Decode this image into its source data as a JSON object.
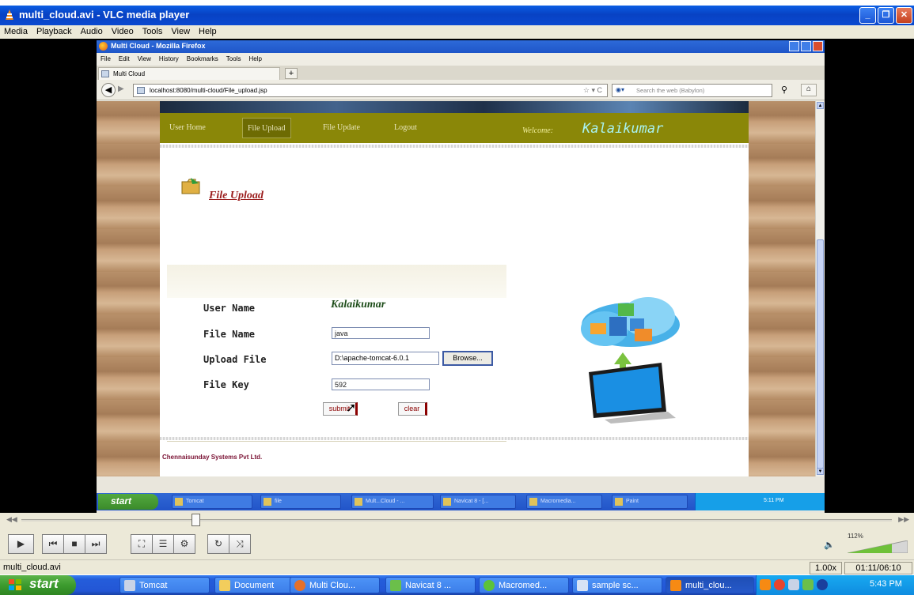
{
  "vlc": {
    "title": "multi_cloud.avi - VLC media player",
    "menu": [
      "Media",
      "Playback",
      "Audio",
      "Video",
      "Tools",
      "View",
      "Help"
    ],
    "seek_position": 0.2,
    "status_filename": "multi_cloud.avi",
    "speed": "1.00x",
    "time": "01:11/06:10",
    "volume": "112%",
    "seek_left": "◀◀",
    "seek_right": "▶▶"
  },
  "firefox": {
    "title": "Multi Cloud - Mozilla Firefox",
    "menu": [
      "File",
      "Edit",
      "View",
      "History",
      "Bookmarks",
      "Tools",
      "Help"
    ],
    "tab_label": "Multi Cloud",
    "url": "localhost:8080/multi-cloud/File_upload.jsp",
    "search_placeholder": "Search the web (Babylon)"
  },
  "site": {
    "nav": [
      "User Home",
      "File Upload",
      "File Update",
      "Logout"
    ],
    "welcome_label": "Welcome:",
    "welcome_name": "Kalaikumar",
    "page_title": "File Upload",
    "footer": "Chennaisunday Systems Pvt Ltd."
  },
  "form": {
    "user_name_label": "User Name",
    "user_name_value": "Kalaikumar",
    "file_name_label": "File Name",
    "file_name_value": "java",
    "upload_label": "Upload File",
    "upload_value": "D:\\apache-tomcat-6.0.1",
    "browse_label": "Browse...",
    "file_key_label": "File Key",
    "file_key_value": "592",
    "submit_label": "submit",
    "clear_label": "clear"
  },
  "inner_taskbar": {
    "start": "start",
    "tasks": [
      "Tomcat",
      "file",
      "Mult...Cloud - ...",
      "Navicat 8 - [...",
      "Macromedia...",
      "Paint"
    ],
    "clock": "5:11 PM"
  },
  "taskbar": {
    "start": "start",
    "tasks": [
      "Tomcat",
      "Document",
      "Multi Clou...",
      "Navicat 8 ...",
      "Macromed...",
      "sample sc...",
      "multi_clou..."
    ],
    "clock": "5:43 PM"
  }
}
